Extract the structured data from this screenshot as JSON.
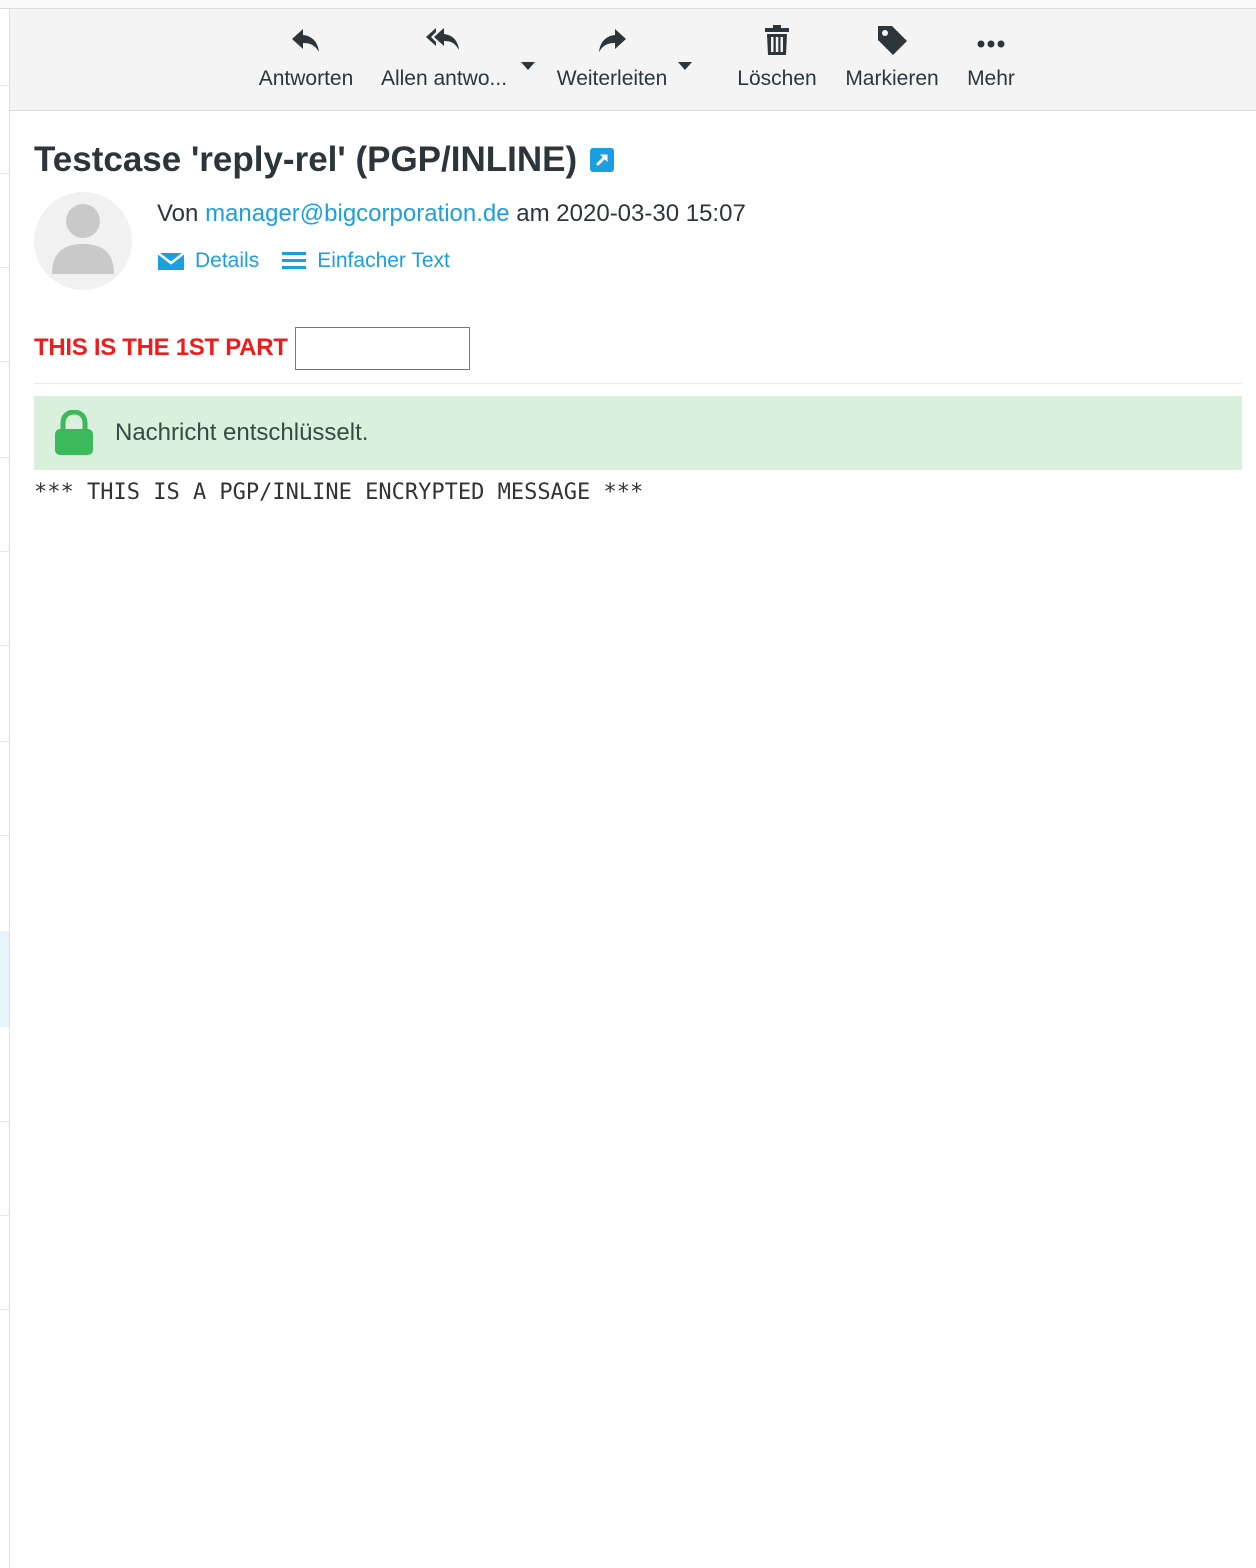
{
  "toolbar": {
    "reply_label": "Antworten",
    "reply_all_label": "Allen antwo...",
    "forward_label": "Weiterleiten",
    "delete_label": "Löschen",
    "mark_label": "Markieren",
    "more_label": "Mehr"
  },
  "message": {
    "subject": "Testcase 'reply-rel' (PGP/INLINE)",
    "from_prefix": "Von",
    "from_address": "manager@bigcorporation.de",
    "date_prefix": "am",
    "date": "2020-03-30 15:07",
    "details_label": "Details",
    "plain_text_label": "Einfacher Text",
    "part1_label": "THIS IS THE 1ST PART",
    "part1_input_value": "",
    "decrypt_notice": "Nachricht entschlüsselt.",
    "body": "*** THIS IS A PGP/INLINE ENCRYPTED MESSAGE ***"
  },
  "colors": {
    "link": "#1c9fe0",
    "part_label": "#ee1d1d",
    "success_bg": "#d8f0dc",
    "success_icon": "#3cb95a",
    "toolbar_bg": "#f4f4f4"
  },
  "icons": {
    "reply": "reply-icon",
    "reply_all": "reply-all-icon",
    "forward": "forward-icon",
    "delete": "trash-icon",
    "mark": "tag-icon",
    "more": "ellipsis-icon",
    "external": "external-link-icon",
    "details": "envelope-icon",
    "plain_text": "lines-icon",
    "lock": "lock-icon",
    "avatar": "user-avatar-icon"
  }
}
